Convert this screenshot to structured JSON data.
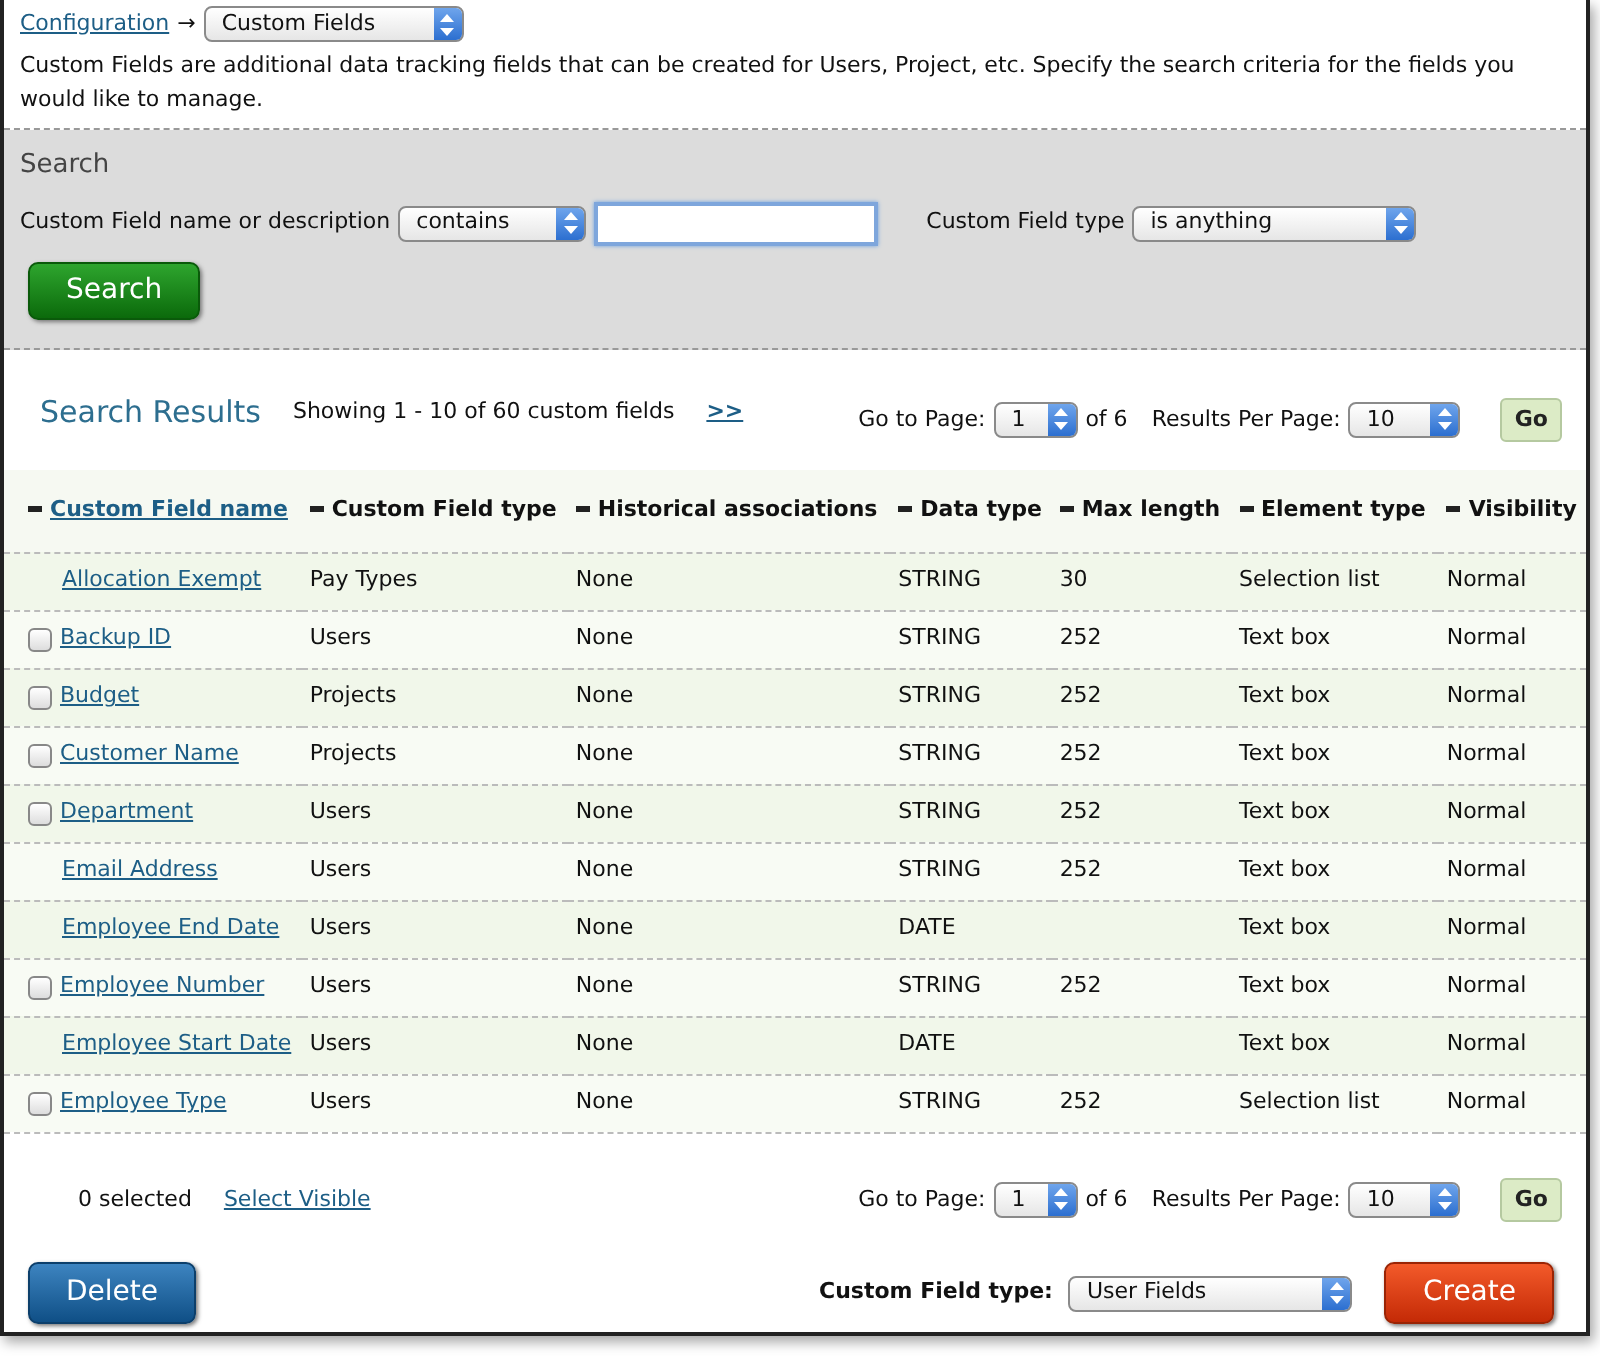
{
  "breadcrumb": {
    "link": "Configuration",
    "arrow": "→",
    "select": "Custom Fields"
  },
  "description": "Custom Fields are additional data tracking fields that can be created for Users, Project, etc. Specify the search criteria for the fields you would like to manage.",
  "search": {
    "title": "Search",
    "name_label": "Custom Field name or description",
    "operator": "contains",
    "type_label": "Custom Field type",
    "type_value": "is anything",
    "button": "Search"
  },
  "results_header": {
    "title": "Search Results",
    "showing": "Showing 1 - 10 of 60 custom fields",
    "next": ">>",
    "goto_label": "Go to Page:",
    "page": "1",
    "of": "of 6",
    "per_page_label": "Results Per Page:",
    "per_page": "10",
    "go": "Go"
  },
  "table": {
    "columns": [
      {
        "label": "Custom Field name",
        "sorted": true
      },
      {
        "label": "Custom Field type",
        "sorted": false
      },
      {
        "label": "Historical associations",
        "sorted": false
      },
      {
        "label": "Data type",
        "sorted": false
      },
      {
        "label": "Max length",
        "sorted": false
      },
      {
        "label": "Element type",
        "sorted": false
      },
      {
        "label": "Visibility",
        "sorted": false
      }
    ],
    "rows": [
      {
        "kind": "plain",
        "cells": [
          "Allocation Exempt",
          "Pay Types",
          "None",
          "STRING",
          "30",
          "Selection list",
          "Normal"
        ]
      },
      {
        "kind": "checkbox",
        "checked": false,
        "cells": [
          "Backup ID",
          "Users",
          "None",
          "STRING",
          "252",
          "Text box",
          "Normal"
        ]
      },
      {
        "kind": "checkbox",
        "checked": false,
        "cells": [
          "Budget",
          "Projects",
          "None",
          "STRING",
          "252",
          "Text box",
          "Normal"
        ]
      },
      {
        "kind": "checkbox",
        "checked": false,
        "cells": [
          "Customer Name",
          "Projects",
          "None",
          "STRING",
          "252",
          "Text box",
          "Normal"
        ]
      },
      {
        "kind": "checkbox",
        "checked": false,
        "cells": [
          "Department",
          "Users",
          "None",
          "STRING",
          "252",
          "Text box",
          "Normal"
        ]
      },
      {
        "kind": "plain",
        "cells": [
          "Email Address",
          "Users",
          "None",
          "STRING",
          "252",
          "Text box",
          "Normal"
        ]
      },
      {
        "kind": "plain",
        "cells": [
          "Employee End Date",
          "Users",
          "None",
          "DATE",
          "",
          "Text box",
          "Normal"
        ]
      },
      {
        "kind": "checkbox",
        "checked": false,
        "cells": [
          "Employee Number",
          "Users",
          "None",
          "STRING",
          "252",
          "Text box",
          "Normal"
        ]
      },
      {
        "kind": "plain",
        "cells": [
          "Employee Start Date",
          "Users",
          "None",
          "DATE",
          "",
          "Text box",
          "Normal"
        ]
      },
      {
        "kind": "checkbox",
        "checked": false,
        "cells": [
          "Employee Type",
          "Users",
          "None",
          "STRING",
          "252",
          "Selection list",
          "Normal"
        ]
      }
    ]
  },
  "footer": {
    "selected": "0  selected",
    "select_visible": "Select Visible",
    "goto_label": "Go to Page:",
    "page": "1",
    "of": "of 6",
    "per_page_label": "Results Per Page:",
    "per_page": "10",
    "go": "Go"
  },
  "actions": {
    "delete": "Delete",
    "type_label": "Custom Field type:",
    "type_value": "User Fields",
    "create": "Create"
  }
}
